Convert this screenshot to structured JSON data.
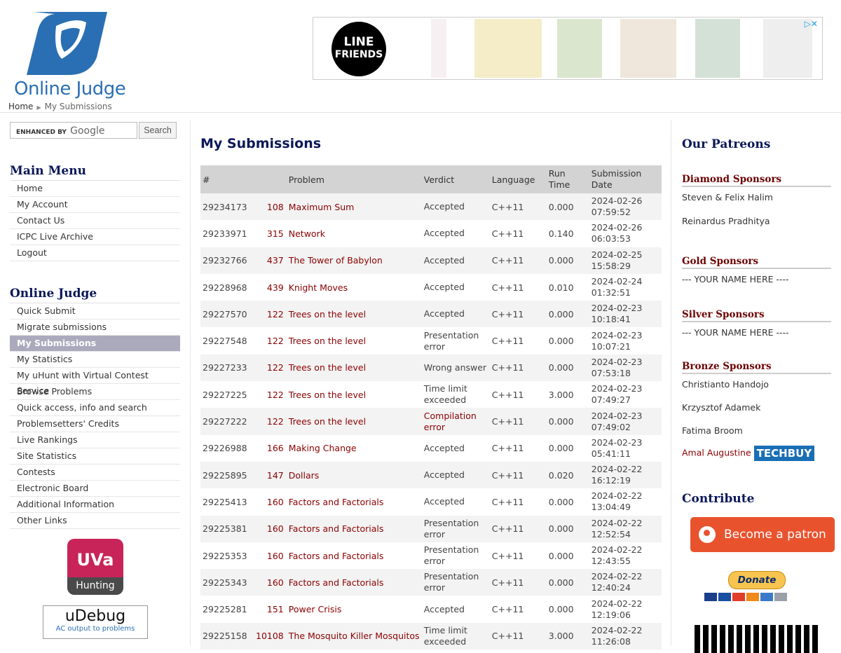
{
  "header": {
    "logo_text": "Online Judge",
    "breadcrumb": {
      "home": "Home",
      "current": "My Submissions"
    }
  },
  "ad": {
    "brand_line1": "LINE",
    "brand_line2": "FRIENDS"
  },
  "search": {
    "placeholder_label": "ENHANCED BY",
    "google": "Google",
    "button": "Search"
  },
  "main_menu": {
    "title": "Main Menu",
    "items": [
      "Home",
      "My Account",
      "Contact Us",
      "ICPC Live Archive",
      "Logout"
    ]
  },
  "online_judge_menu": {
    "title": "Online Judge",
    "items": [
      "Quick Submit",
      "Migrate submissions",
      "My Submissions",
      "My Statistics",
      "My uHunt with Virtual Contest Service",
      "Browse Problems",
      "Quick access, info and search",
      "Problemsetters' Credits",
      "Live Rankings",
      "Site Statistics",
      "Contests",
      "Electronic Board",
      "Additional Information",
      "Other Links"
    ],
    "active": "My Submissions"
  },
  "badges": {
    "uva_top": "UVa",
    "uva_bottom": "Hunting",
    "udebug_title": "uDebug",
    "udebug_sub": "AC output to problems"
  },
  "main": {
    "title": "My Submissions",
    "columns": {
      "id": "#",
      "problem": "Problem",
      "verdict": "Verdict",
      "language": "Language",
      "runtime": "Run Time",
      "date": "Submission Date"
    },
    "rows": [
      {
        "id": "29234173",
        "pnum": "108",
        "pname": "Maximum Sum",
        "verdict": "Accepted",
        "lang": "C++11",
        "time": "0.000",
        "date1": "2024-02-26",
        "date2": "07:59:52"
      },
      {
        "id": "29233971",
        "pnum": "315",
        "pname": "Network",
        "verdict": "Accepted",
        "lang": "C++11",
        "time": "0.140",
        "date1": "2024-02-26",
        "date2": "06:03:53"
      },
      {
        "id": "29232766",
        "pnum": "437",
        "pname": "The Tower of Babylon",
        "verdict": "Accepted",
        "lang": "C++11",
        "time": "0.000",
        "date1": "2024-02-25",
        "date2": "15:58:29"
      },
      {
        "id": "29228968",
        "pnum": "439",
        "pname": "Knight Moves",
        "verdict": "Accepted",
        "lang": "C++11",
        "time": "0.010",
        "date1": "2024-02-24",
        "date2": "01:32:51"
      },
      {
        "id": "29227570",
        "pnum": "122",
        "pname": "Trees on the level",
        "verdict": "Accepted",
        "lang": "C++11",
        "time": "0.000",
        "date1": "2024-02-23",
        "date2": "10:18:41"
      },
      {
        "id": "29227548",
        "pnum": "122",
        "pname": "Trees on the level",
        "verdict": "Presentation error",
        "lang": "C++11",
        "time": "0.000",
        "date1": "2024-02-23",
        "date2": "10:07:21"
      },
      {
        "id": "29227233",
        "pnum": "122",
        "pname": "Trees on the level",
        "verdict": "Wrong answer",
        "lang": "C++11",
        "time": "0.000",
        "date1": "2024-02-23",
        "date2": "07:53:18"
      },
      {
        "id": "29227225",
        "pnum": "122",
        "pname": "Trees on the level",
        "verdict": "Time limit exceeded",
        "lang": "C++11",
        "time": "3.000",
        "date1": "2024-02-23",
        "date2": "07:49:27"
      },
      {
        "id": "29227222",
        "pnum": "122",
        "pname": "Trees on the level",
        "verdict": "Compilation error",
        "lang": "C++11",
        "time": "0.000",
        "date1": "2024-02-23",
        "date2": "07:49:02"
      },
      {
        "id": "29226988",
        "pnum": "166",
        "pname": "Making Change",
        "verdict": "Accepted",
        "lang": "C++11",
        "time": "0.000",
        "date1": "2024-02-23",
        "date2": "05:41:11"
      },
      {
        "id": "29225895",
        "pnum": "147",
        "pname": "Dollars",
        "verdict": "Accepted",
        "lang": "C++11",
        "time": "0.020",
        "date1": "2024-02-22",
        "date2": "16:12:19"
      },
      {
        "id": "29225413",
        "pnum": "160",
        "pname": "Factors and Factorials",
        "verdict": "Accepted",
        "lang": "C++11",
        "time": "0.000",
        "date1": "2024-02-22",
        "date2": "13:04:49"
      },
      {
        "id": "29225381",
        "pnum": "160",
        "pname": "Factors and Factorials",
        "verdict": "Presentation error",
        "lang": "C++11",
        "time": "0.000",
        "date1": "2024-02-22",
        "date2": "12:52:54"
      },
      {
        "id": "29225353",
        "pnum": "160",
        "pname": "Factors and Factorials",
        "verdict": "Presentation error",
        "lang": "C++11",
        "time": "0.000",
        "date1": "2024-02-22",
        "date2": "12:43:55"
      },
      {
        "id": "29225343",
        "pnum": "160",
        "pname": "Factors and Factorials",
        "verdict": "Presentation error",
        "lang": "C++11",
        "time": "0.000",
        "date1": "2024-02-22",
        "date2": "12:40:24"
      },
      {
        "id": "29225281",
        "pnum": "151",
        "pname": "Power Crisis",
        "verdict": "Accepted",
        "lang": "C++11",
        "time": "0.000",
        "date1": "2024-02-22",
        "date2": "12:19:06"
      },
      {
        "id": "29225158",
        "pnum": "10108",
        "pname": "The Mosquito Killer Mosquitos",
        "verdict": "Time limit exceeded",
        "lang": "C++11",
        "time": "3.000",
        "date1": "2024-02-22",
        "date2": "11:26:08"
      }
    ]
  },
  "right": {
    "patreons_title": "Our Patreons",
    "diamond": {
      "title": "Diamond Sponsors",
      "names": [
        "Steven & Felix Halim",
        "Reinardus Pradhitya"
      ]
    },
    "gold": {
      "title": "Gold Sponsors",
      "names": [
        "--- YOUR NAME HERE ----"
      ]
    },
    "silver": {
      "title": "Silver Sponsors",
      "names": [
        "--- YOUR NAME HERE ----"
      ]
    },
    "bronze": {
      "title": "Bronze Sponsors",
      "names": [
        "Christianto Handojo",
        "Krzysztof Adamek",
        "Fatima Broom",
        "Amal Augustine"
      ]
    },
    "techbuy": "TECHBUY",
    "contribute_title": "Contribute",
    "patron_button": "Become a patron",
    "donate_button": "Donate"
  },
  "colors": {
    "accent_title": "#0a1858",
    "link": "#8b0000",
    "active_menu": "#abaabd",
    "patron": "#e8532e"
  }
}
